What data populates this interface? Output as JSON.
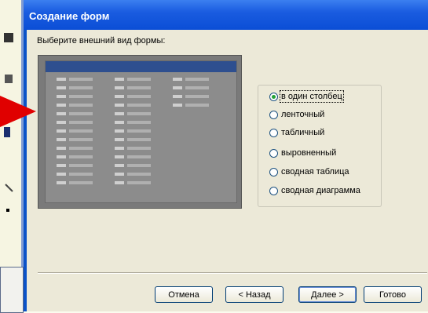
{
  "dialog": {
    "title": "Создание форм",
    "prompt": "Выберите внешний вид формы:"
  },
  "layout_options": [
    {
      "label": "в один столбец",
      "selected": true
    },
    {
      "label": "ленточный",
      "selected": false
    },
    {
      "label": "табличный",
      "selected": false
    },
    {
      "label": "выровненный",
      "selected": false
    },
    {
      "label": "сводная таблица",
      "selected": false
    },
    {
      "label": "сводная диаграмма",
      "selected": false
    }
  ],
  "buttons": {
    "cancel": "Отмена",
    "back": "< Назад",
    "next": "Далее >",
    "finish": "Готово"
  },
  "colors": {
    "title_bar": "#0b4ed6",
    "dialog_face": "#ece9d8",
    "arrow": "#e00000",
    "selected_radio": "#23a136"
  }
}
